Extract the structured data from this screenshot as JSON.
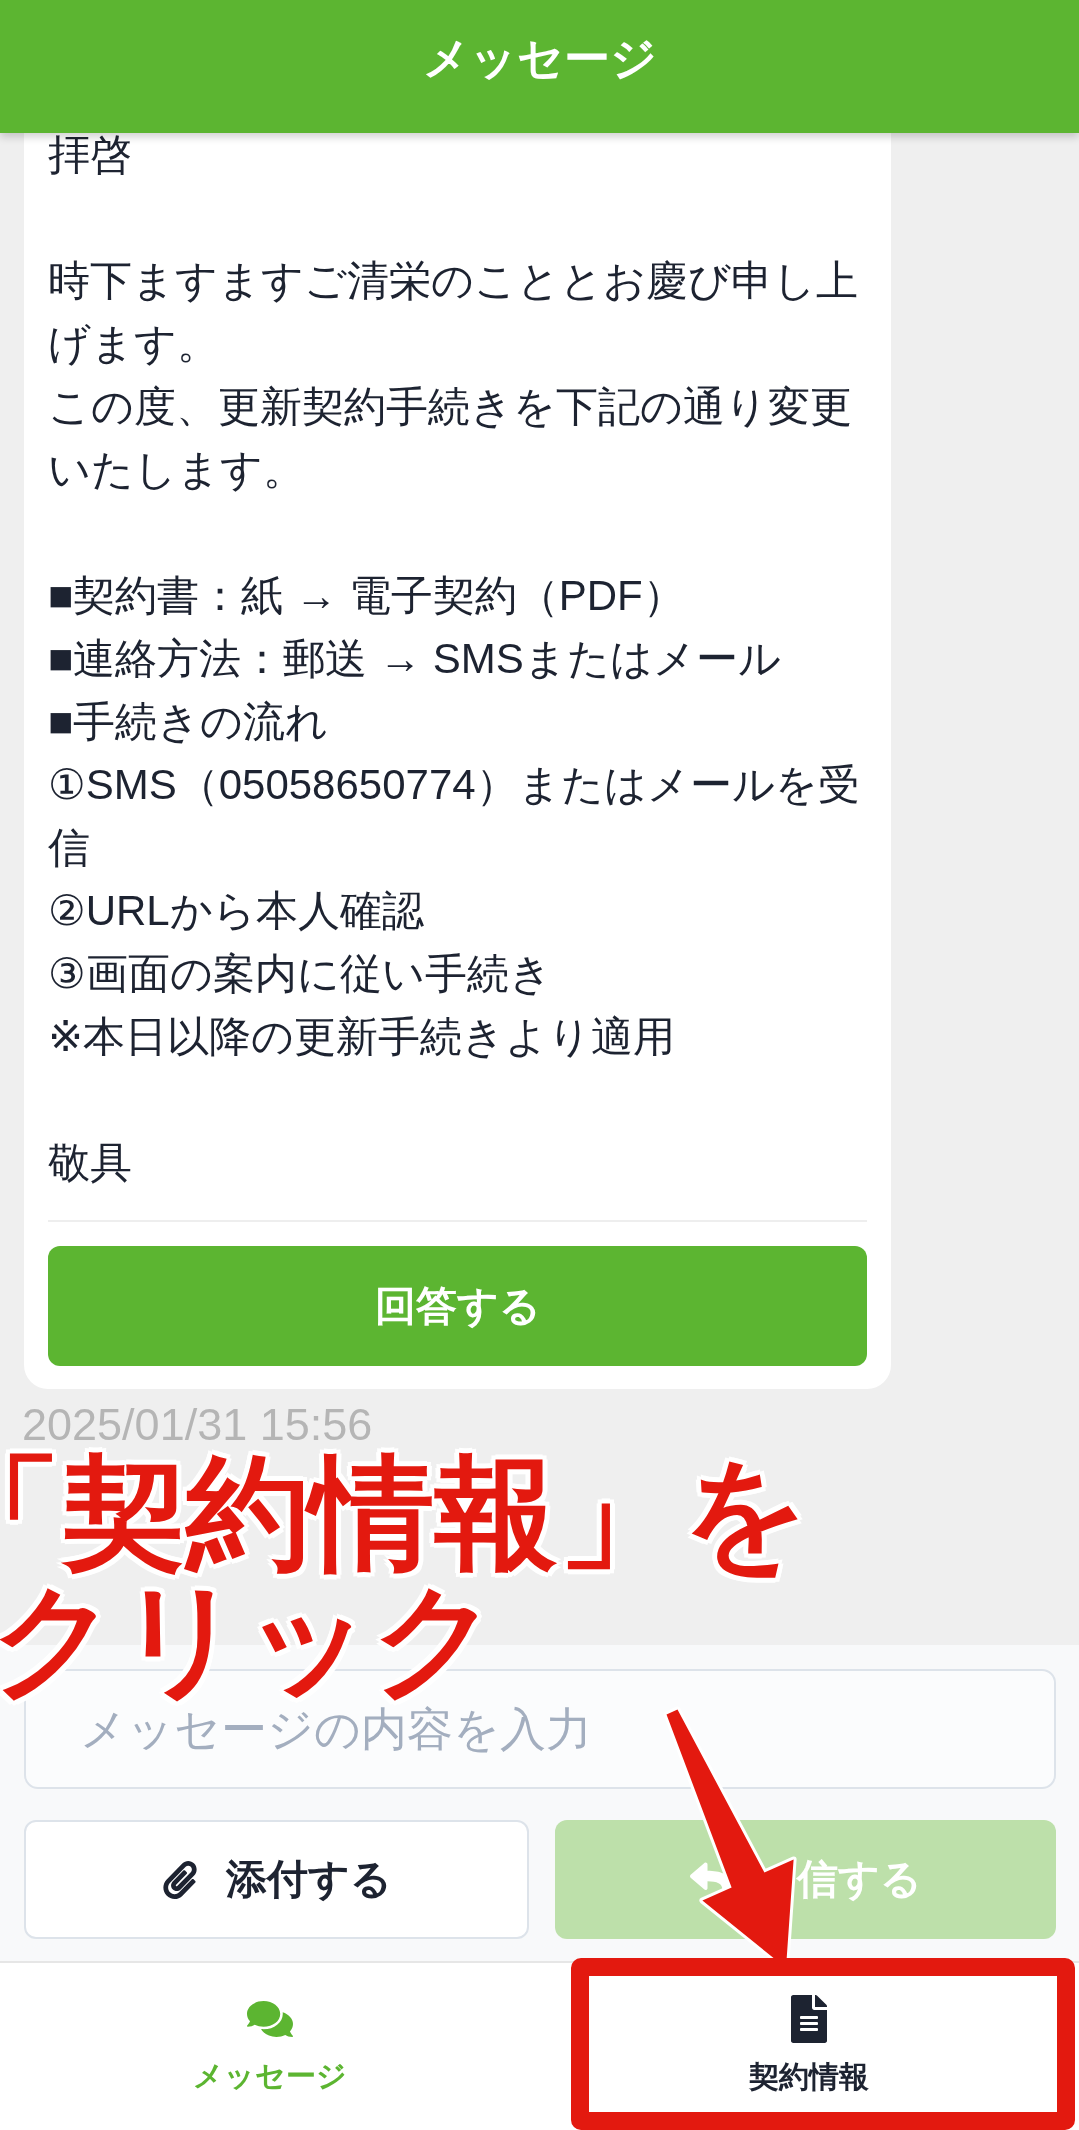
{
  "header": {
    "title": "メッセージ"
  },
  "message": {
    "paragraphs": [
      [
        "拝啓"
      ],
      [
        "時下ますますご清栄のこととお慶び申し上げます。",
        "この度、更新契約手続きを下記の通り変更いたします。"
      ],
      [
        "■契約書：紙 → 電子契約（PDF）",
        "■連絡方法：郵送 → SMSまたはメール",
        "■手続きの流れ",
        "①SMS（05058650774）またはメールを受信",
        "②URLから本人確認",
        "③画面の案内に従い手続き",
        "※本日以降の更新手続きより適用"
      ],
      [
        "敬具"
      ]
    ],
    "action": "回答する",
    "timestamp": "2025/01/31 15:56"
  },
  "composer": {
    "placeholder": "メッセージの内容を入力",
    "buttons": [
      {
        "kind": "attach",
        "label": "添付する",
        "disabled": false
      },
      {
        "kind": "reply",
        "label": "信する",
        "disabled": true
      }
    ]
  },
  "tab_bar": {
    "tabs": [
      {
        "kind": "messages",
        "label": "メッセージ",
        "selected": true
      },
      {
        "kind": "contract",
        "label": "契約情報",
        "selected": false
      }
    ]
  },
  "annotation": {
    "lines": [
      "「契約情報」を",
      "クリック"
    ]
  }
}
